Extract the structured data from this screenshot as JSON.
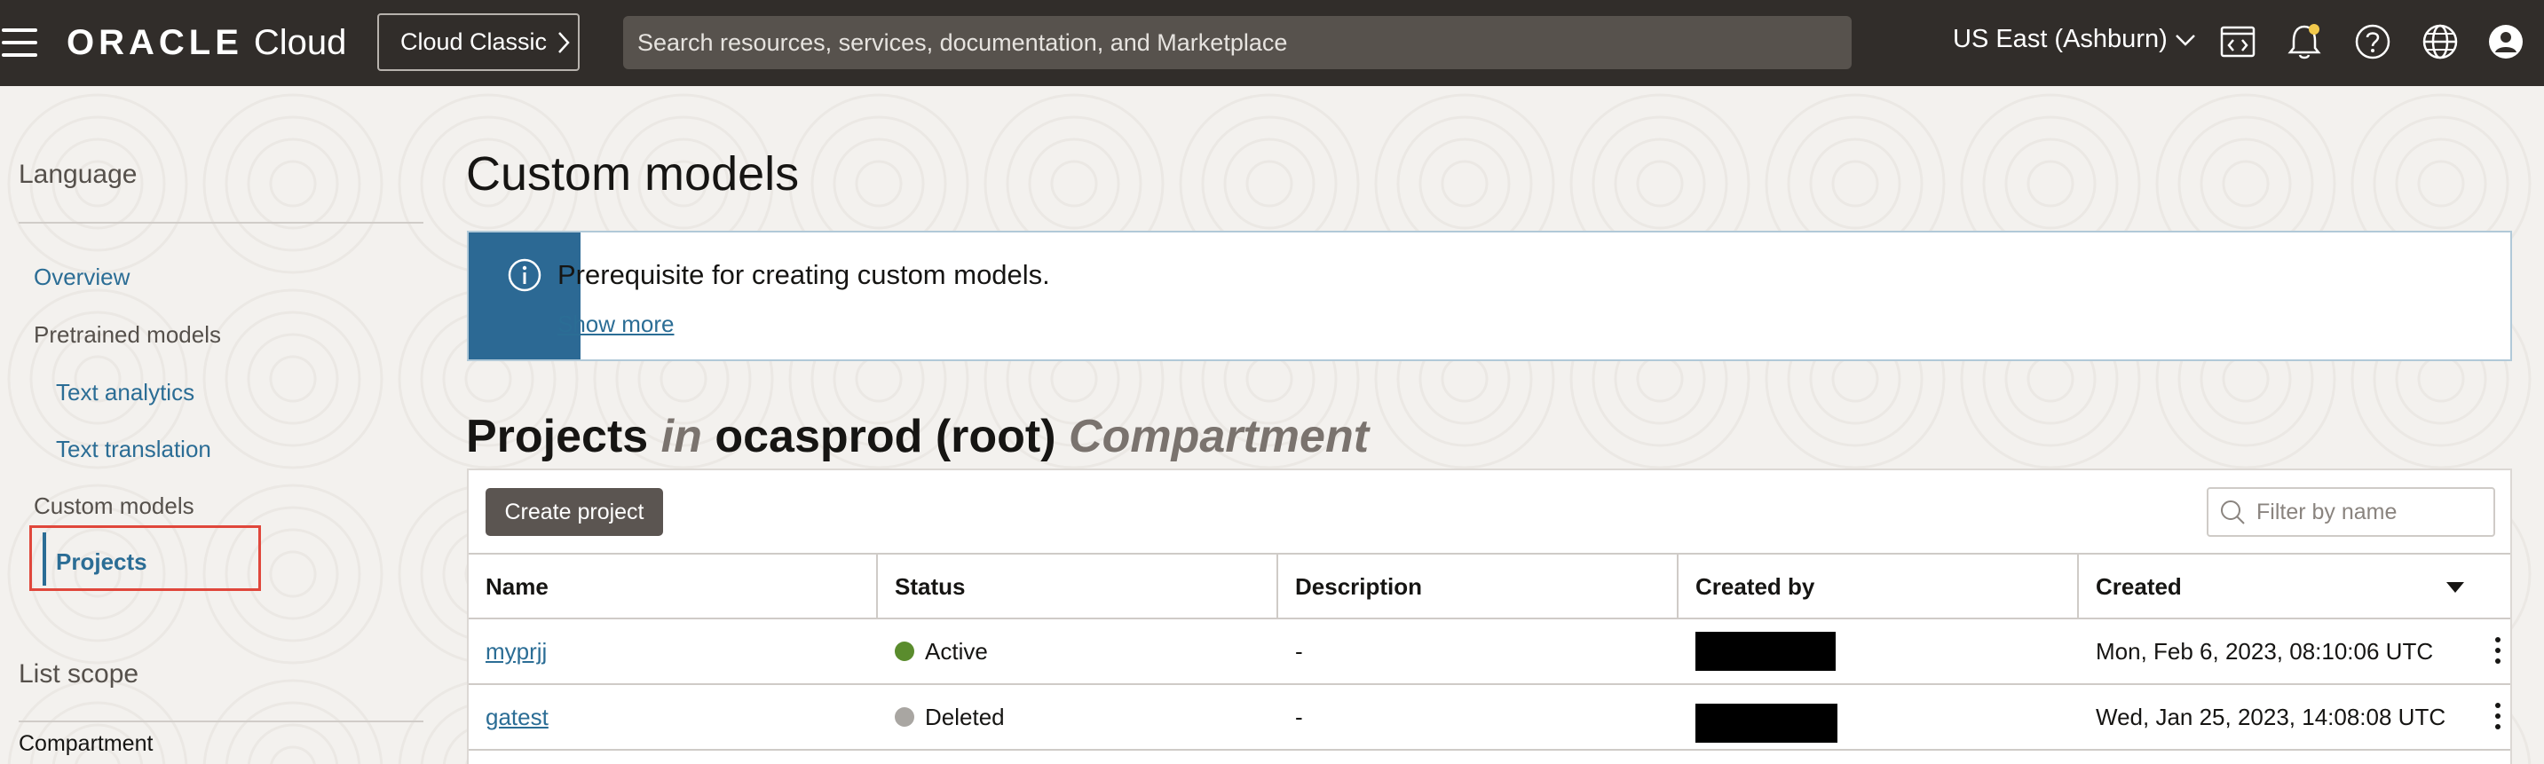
{
  "topbar": {
    "logo_brand": "ORACLE",
    "logo_product": "Cloud",
    "classic_button": "Cloud Classic",
    "search_placeholder": "Search resources, services, documentation, and Marketplace",
    "region": "US East (Ashburn)",
    "icons": [
      "code-editor-icon",
      "bell-icon",
      "help-icon",
      "globe-icon",
      "user-icon"
    ],
    "bg_color": "#312d2a"
  },
  "sidebar": {
    "title": "Language",
    "items": [
      {
        "label": "Overview",
        "kind": "link"
      },
      {
        "label": "Pretrained models",
        "kind": "heading"
      },
      {
        "label": "Text analytics",
        "kind": "sublink"
      },
      {
        "label": "Text translation",
        "kind": "sublink"
      },
      {
        "label": "Custom models",
        "kind": "heading"
      },
      {
        "label": "Projects",
        "kind": "active"
      }
    ],
    "scope_title": "List scope",
    "compartment_label": "Compartment"
  },
  "main": {
    "title": "Custom models",
    "info": {
      "message": "Prerequisite for creating custom models.",
      "link": "Show more"
    },
    "section": {
      "prefix": "Projects",
      "in": "in",
      "compartment": "ocasprod (root)",
      "suffix": "Compartment"
    },
    "create_button": "Create project",
    "filter_placeholder": "Filter by name",
    "columns": [
      "Name",
      "Status",
      "Description",
      "Created by",
      "Created"
    ],
    "rows": [
      {
        "name": "myprjj",
        "status": "Active",
        "status_color": "#5a8c2d",
        "description": "-",
        "created": "Mon, Feb 6, 2023, 08:10:06 UTC"
      },
      {
        "name": "gatest",
        "status": "Deleted",
        "status_color": "#a9a6a2",
        "description": "-",
        "created": "Wed, Jan 25, 2023, 14:08:08 UTC"
      }
    ]
  }
}
